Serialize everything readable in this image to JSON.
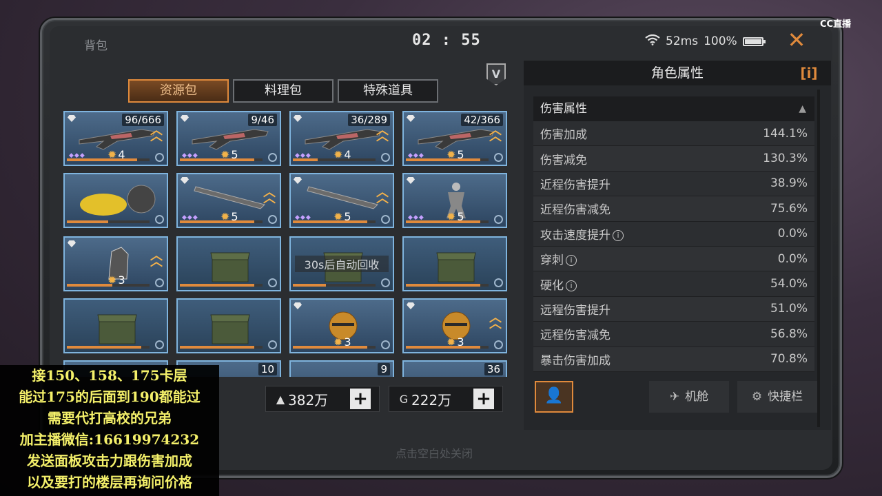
{
  "header": {
    "title": "背包",
    "timer": "02 : 55",
    "ping": "52ms",
    "battery": "100%",
    "battery_level": 1.0,
    "watermark": "CC直播"
  },
  "vip_badge": "V",
  "tabs": [
    {
      "label": "资源包",
      "active": true
    },
    {
      "label": "料理包",
      "active": false
    },
    {
      "label": "特殊道具",
      "active": false
    }
  ],
  "inventory": [
    {
      "kind": "weapon",
      "count": "96/666",
      "level": "4",
      "gem": true,
      "upgrade": true,
      "dots": true,
      "progress": 0.85
    },
    {
      "kind": "weapon",
      "count": "9/46",
      "level": "5",
      "gem": true,
      "upgrade": false,
      "dots": true,
      "progress": 0.9
    },
    {
      "kind": "weapon",
      "count": "36/289",
      "level": "4",
      "gem": true,
      "upgrade": true,
      "dots": true,
      "progress": 0.3
    },
    {
      "kind": "weapon",
      "count": "42/366",
      "level": "5",
      "gem": true,
      "upgrade": true,
      "dots": true,
      "progress": 0.9
    },
    {
      "kind": "vehicle",
      "count": "",
      "level": "",
      "gem": false,
      "upgrade": false,
      "dots": false,
      "progress": 0.5
    },
    {
      "kind": "blade",
      "count": "",
      "level": "5",
      "gem": true,
      "upgrade": true,
      "dots": true,
      "progress": 0.9
    },
    {
      "kind": "blade",
      "count": "",
      "level": "5",
      "gem": true,
      "upgrade": true,
      "dots": true,
      "progress": 0.9
    },
    {
      "kind": "figure",
      "count": "",
      "level": "5",
      "gem": true,
      "upgrade": false,
      "dots": true,
      "progress": 0.9
    },
    {
      "kind": "head",
      "count": "",
      "level": "3",
      "gem": true,
      "upgrade": true,
      "dots": false,
      "progress": 0.55
    },
    {
      "kind": "crate",
      "count": "",
      "level": "",
      "gem": false,
      "upgrade": false,
      "dots": false,
      "progress": 0.9
    },
    {
      "kind": "crate",
      "count": "",
      "level": "",
      "gem": false,
      "upgrade": false,
      "dots": false,
      "progress": 0.4,
      "overlay": "30s后自动回收"
    },
    {
      "kind": "crate",
      "count": "",
      "level": "",
      "gem": false,
      "upgrade": false,
      "dots": false,
      "progress": 0.9
    },
    {
      "kind": "crate",
      "count": "",
      "level": "",
      "gem": false,
      "upgrade": false,
      "dots": false,
      "progress": 0.9
    },
    {
      "kind": "crate",
      "count": "",
      "level": "",
      "gem": false,
      "upgrade": false,
      "dots": false,
      "progress": 0.9
    },
    {
      "kind": "armor",
      "count": "",
      "level": "3",
      "gem": true,
      "upgrade": false,
      "dots": false,
      "progress": 0.9
    },
    {
      "kind": "armor",
      "count": "",
      "level": "3",
      "gem": true,
      "upgrade": true,
      "dots": false,
      "progress": 0.9
    },
    {
      "kind": "misc",
      "count": "",
      "level": "",
      "gem": false,
      "upgrade": false,
      "dots": false,
      "progress": 0
    },
    {
      "kind": "misc",
      "count": "10",
      "level": "",
      "gem": false,
      "upgrade": false,
      "dots": false,
      "progress": 0
    },
    {
      "kind": "misc",
      "count": "9",
      "level": "",
      "gem": false,
      "upgrade": false,
      "dots": false,
      "progress": 0
    },
    {
      "kind": "misc",
      "count": "36",
      "level": "",
      "gem": false,
      "upgrade": false,
      "dots": false,
      "progress": 0
    }
  ],
  "currencies": [
    {
      "icon": "crystal-icon",
      "value": "382万"
    },
    {
      "icon": "coin-icon",
      "value": "222万"
    }
  ],
  "close_hint": "点击空白处关闭",
  "attributes": {
    "panel_title": "角色属性",
    "info_label": "[i]",
    "section_title": "伤害属性",
    "rows": [
      {
        "label": "伤害加成",
        "value": "144.1%",
        "info": false
      },
      {
        "label": "伤害减免",
        "value": "130.3%",
        "info": false
      },
      {
        "label": "近程伤害提升",
        "value": "38.9%",
        "info": false
      },
      {
        "label": "近程伤害减免",
        "value": "75.6%",
        "info": false
      },
      {
        "label": "攻击速度提升",
        "value": "0.0%",
        "info": true
      },
      {
        "label": "穿刺",
        "value": "0.0%",
        "info": true
      },
      {
        "label": "硬化",
        "value": "54.0%",
        "info": true
      },
      {
        "label": "远程伤害提升",
        "value": "51.0%",
        "info": false
      },
      {
        "label": "远程伤害减免",
        "value": "56.8%",
        "info": false
      },
      {
        "label": "暴击伤害加成",
        "value": "70.8%",
        "info": false
      }
    ]
  },
  "bottom_buttons": {
    "cabin": "机舱",
    "shortcut": "快捷栏"
  },
  "promo": [
    "接150、158、175卡层",
    "能过175的后面到190都能过",
    "需要代打高校的兄弟",
    "加主播微信:16619974232",
    "发送面板攻击力跟伤害加成",
    "以及要打的楼层再询问价格"
  ],
  "colors": {
    "accent": "#e08a3c",
    "cell_border": "#7fb4de",
    "promo_text": "#f4f06a"
  }
}
